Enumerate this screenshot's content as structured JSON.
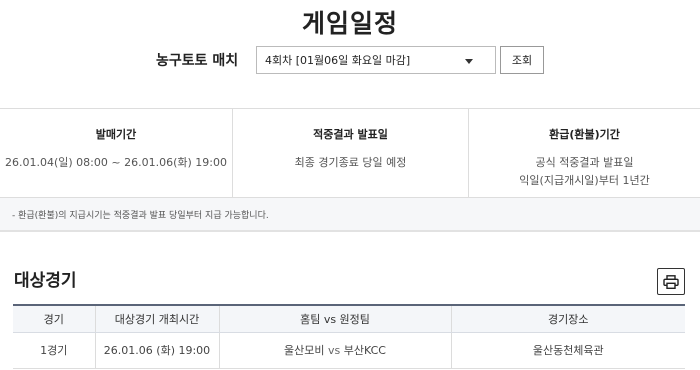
{
  "header": {
    "title": "게임일정"
  },
  "match_selector": {
    "label": "농구토토 매치",
    "selected": "4회차 [01월06일 화요일 마감]",
    "search_label": "조회"
  },
  "info": {
    "sale_period": {
      "heading": "발매기간",
      "value": "26.01.04(일) 08:00 ~ 26.01.06(화) 19:00"
    },
    "announce": {
      "heading": "적중결과 발표일",
      "value": "최종 경기종료 당일 예정"
    },
    "refund": {
      "heading": "환급(환불)기간",
      "line1": "공식 적중결과 발표일",
      "line2": "익일(지급개시일)부터 1년간"
    }
  },
  "notice": "- 환급(환불)의 지급시기는 적중결과 발표 당일부터 지급 가능합니다.",
  "section": {
    "title": "대상경기",
    "print_icon": "printer-icon"
  },
  "table": {
    "headers": [
      "경기",
      "대상경기 개최시간",
      "홈팀 vs 원정팀",
      "경기장소"
    ],
    "rows": [
      {
        "game": "1경기",
        "time": "26.01.06 (화) 19:00",
        "home": "울산모비",
        "vs": "vs",
        "away": "부산KCC",
        "venue": "울산동천체육관"
      }
    ]
  }
}
